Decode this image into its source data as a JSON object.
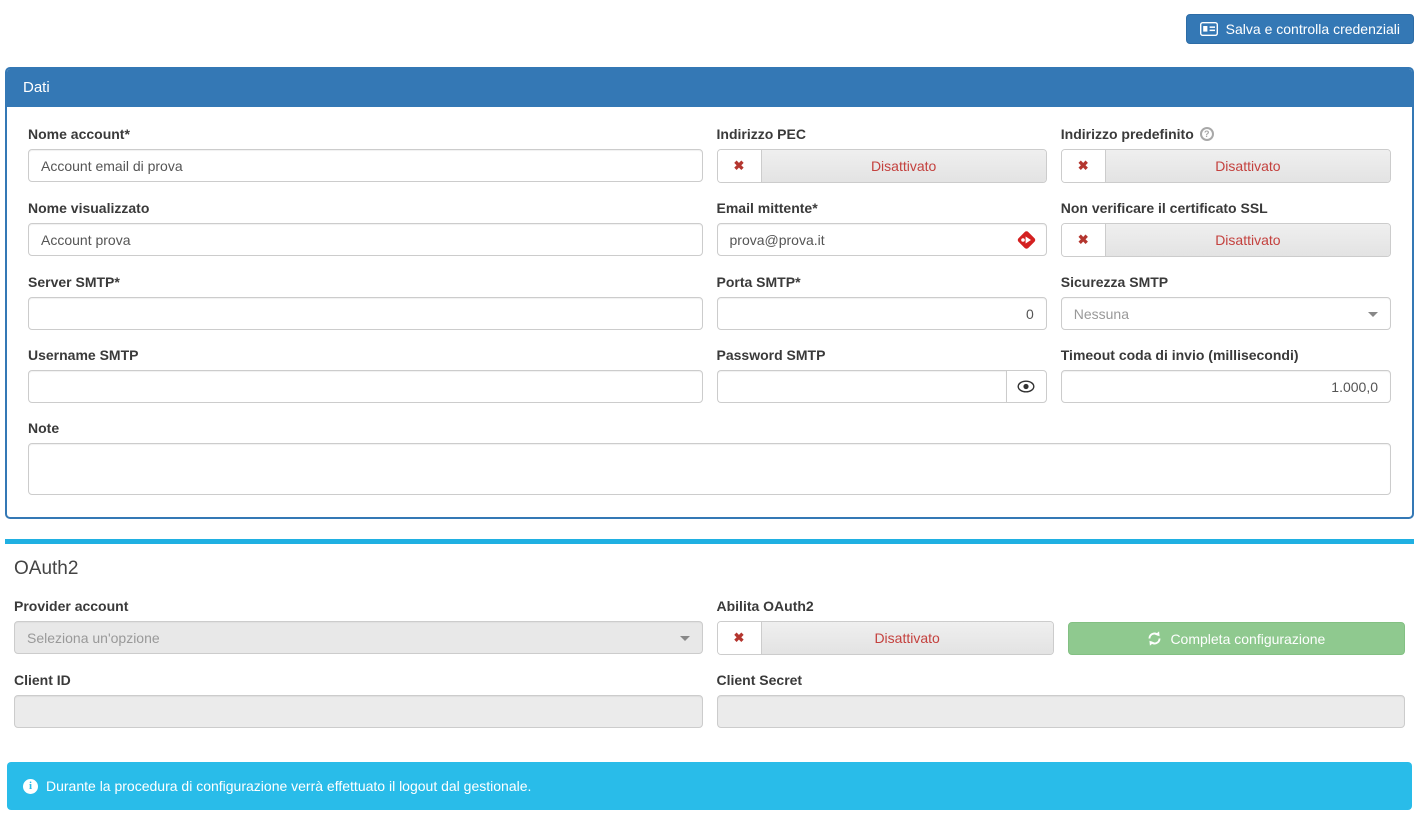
{
  "colors": {
    "primary_blue": "#3478b5",
    "toggle_red": "#c4413e",
    "x_icon_red": "#b4362f",
    "forward_icon_red": "#d42020",
    "success_green": "#8fc98f",
    "info_cyan": "#29bce9",
    "divider_cyan": "#20b0e2"
  },
  "toolbar": {
    "save_label": "Salva e controlla credenziali"
  },
  "dati": {
    "title": "Dati",
    "fields": {
      "nome_account": {
        "label": "Nome account*",
        "value": "Account email di prova"
      },
      "nome_visualizzato": {
        "label": "Nome visualizzato",
        "value": "Account prova"
      },
      "server_smtp": {
        "label": "Server SMTP*",
        "value": ""
      },
      "username_smtp": {
        "label": "Username SMTP",
        "value": ""
      },
      "indirizzo_pec": {
        "label": "Indirizzo PEC",
        "state": "Disattivato"
      },
      "email_mittente": {
        "label": "Email mittente*",
        "value": "prova@prova.it"
      },
      "porta_smtp": {
        "label": "Porta SMTP*",
        "value": "0"
      },
      "password_smtp": {
        "label": "Password SMTP",
        "value": ""
      },
      "indirizzo_predefinito": {
        "label": "Indirizzo predefinito",
        "state": "Disattivato"
      },
      "non_verificare_ssl": {
        "label": "Non verificare il certificato SSL",
        "state": "Disattivato"
      },
      "sicurezza_smtp": {
        "label": "Sicurezza SMTP",
        "selected": "Nessuna"
      },
      "timeout": {
        "label": "Timeout coda di invio (millisecondi)",
        "value": "1.000,0"
      },
      "note": {
        "label": "Note",
        "value": ""
      }
    }
  },
  "oauth2": {
    "title": "OAuth2",
    "provider": {
      "label": "Provider account",
      "selected": "Seleziona un'opzione"
    },
    "abilita": {
      "label": "Abilita OAuth2",
      "state": "Disattivato"
    },
    "completa_label": "Completa configurazione",
    "client_id": {
      "label": "Client ID",
      "value": ""
    },
    "client_secret": {
      "label": "Client Secret",
      "value": ""
    },
    "info_message": "Durante la procedura di configurazione verrà effettuato il logout dal gestionale."
  }
}
